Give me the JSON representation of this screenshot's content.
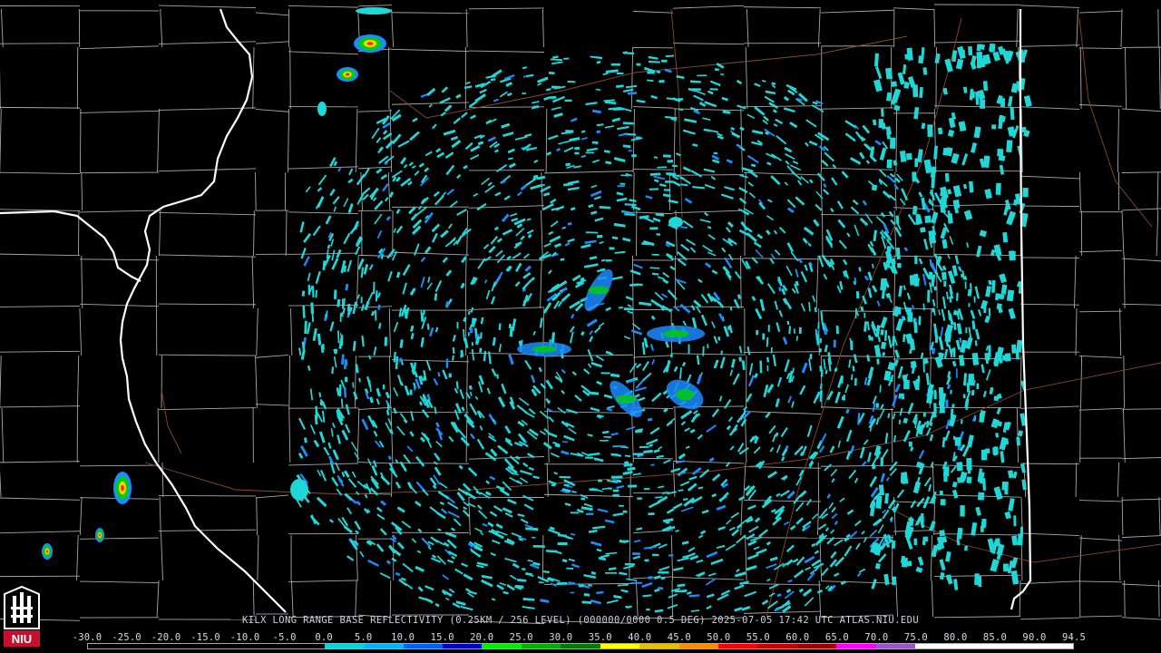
{
  "product": {
    "caption": "KILX LONG RANGE BASE REFLECTIVITY (0.25KM / 256 LEVEL) (000000/0000 0.5 DEG) 2025-07-05 17:42 UTC  ATLAS.NIU.EDU"
  },
  "logo": {
    "text": "NIU",
    "colors": {
      "red": "#c8102e",
      "white": "#ffffff",
      "black": "#000000"
    }
  },
  "color_scale": {
    "labels": [
      "-30.0",
      "-25.0",
      "-20.0",
      "-15.0",
      "-10.0",
      "-5.0",
      "0.0",
      "5.0",
      "10.0",
      "15.0",
      "20.0",
      "25.0",
      "30.0",
      "35.0",
      "40.0",
      "45.0",
      "50.0",
      "55.0",
      "60.0",
      "65.0",
      "70.0",
      "75.0",
      "80.0",
      "85.0",
      "90.0",
      "94.5"
    ],
    "segments": [
      "#000000",
      "#000000",
      "#000000",
      "#000000",
      "#000000",
      "#000000",
      "#00d8d8",
      "#00b4ff",
      "#0060ff",
      "#0000cc",
      "#00ee00",
      "#00b000",
      "#007a00",
      "#ffff00",
      "#e8c000",
      "#ff8c00",
      "#ff0000",
      "#c80000",
      "#a00000",
      "#ff00ff",
      "#9a55c9",
      "#ffffff",
      "#ffffff",
      "#ffffff",
      "#ffffff"
    ]
  },
  "map_colors": {
    "background": "#000000",
    "county_lines": "#a7a7a7",
    "state_lines": "#ffffff",
    "highways": "#8a4a2a",
    "echo_light": "#1fd7d7",
    "echo_medium": "#1a8cff",
    "echo_core": "#00d000",
    "echo_strong": "#ffd000",
    "echo_max": "#ff2000",
    "radar_site": "#000000"
  }
}
